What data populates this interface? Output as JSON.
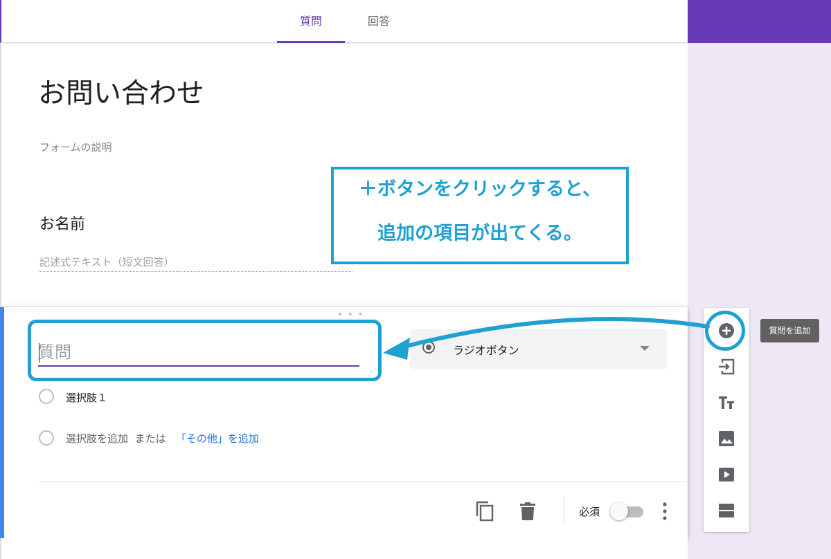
{
  "header": {
    "tabs": [
      {
        "label": "質問"
      },
      {
        "label": "回答"
      }
    ]
  },
  "form": {
    "title": "お問い合わせ",
    "description_placeholder": "フォームの説明"
  },
  "question1": {
    "title": "お名前",
    "answer_hint": "記述式テキスト（短文回答）"
  },
  "question2": {
    "title_placeholder": "質問",
    "type": "ラジオボタン",
    "option1": "選択肢１",
    "add_option": "選択肢を追加",
    "or_text": "または",
    "add_other": "「その他」を追加",
    "required_label": "必須",
    "required": false
  },
  "annotation": {
    "line1": "＋ボタンをクリックすると、",
    "line2": "追加の項目が出てくる。"
  },
  "toolbar": {
    "tooltip": "質問を追加"
  },
  "colors": {
    "accent": "#673ab7",
    "annotation": "#1ea0d3",
    "active_border": "#4285f4",
    "link": "#1a73e8"
  }
}
